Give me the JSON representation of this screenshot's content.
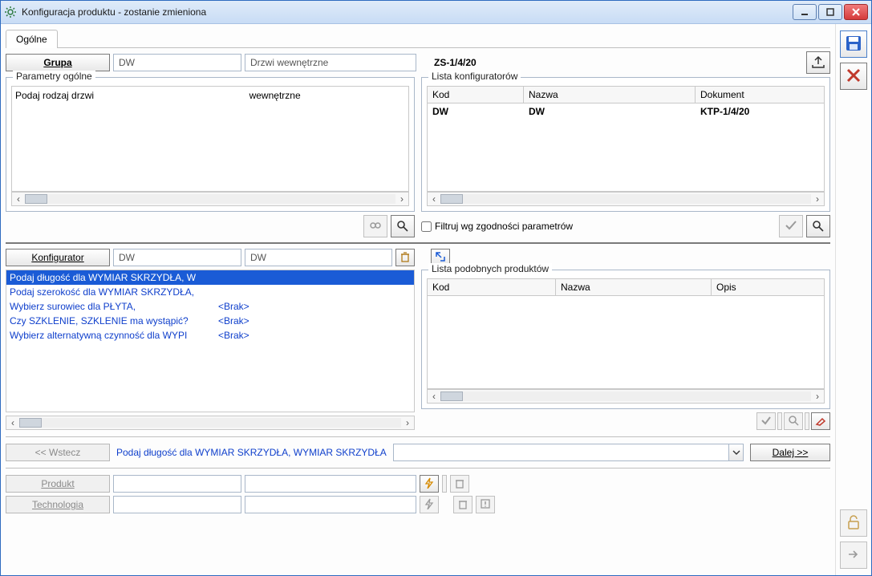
{
  "window": {
    "title": "Konfiguracja produktu - zostanie zmieniona"
  },
  "tabs": {
    "general": "Ogólne"
  },
  "grupa": {
    "btn": "Grupa",
    "code": "DW",
    "name": "Drzwi wewnętrzne"
  },
  "document_code": "ZS-1/4/20",
  "parametry_ogolne": {
    "legend": "Parametry ogólne",
    "col_label": "Podaj rodzaj drzwi",
    "col_value": "wewnętrzne"
  },
  "lista_konfiguratorow": {
    "legend": "Lista konfiguratorów",
    "hdr": {
      "kod": "Kod",
      "nazwa": "Nazwa",
      "dokument": "Dokument"
    },
    "rows": [
      {
        "kod": "DW",
        "nazwa": "DW",
        "dokument": "KTP-1/4/20"
      }
    ],
    "filter_label": "Filtruj wg zgodności parametrów"
  },
  "konfigurator": {
    "btn": "Konfigurator",
    "code": "DW",
    "name": "DW"
  },
  "steps": [
    {
      "label": "Podaj długość dla WYMIAR SKRZYDŁA, W",
      "value": "",
      "selected": true
    },
    {
      "label": "Podaj szerokość dla WYMIAR SKRZYDŁA,",
      "value": "",
      "selected": false
    },
    {
      "label": "Wybierz surowiec dla PŁYTA,",
      "value": "<Brak>",
      "selected": false
    },
    {
      "label": "Czy SZKLENIE, SZKLENIE ma wystąpić?",
      "value": "<Brak>",
      "selected": false
    },
    {
      "label": "Wybierz alternatywną czynność dla WYPI",
      "value": "<Brak>",
      "selected": false
    }
  ],
  "lista_podobnych": {
    "legend": "Lista podobnych produktów",
    "hdr": {
      "kod": "Kod",
      "nazwa": "Nazwa",
      "opis": "Opis"
    }
  },
  "wizard": {
    "back": "<< Wstecz",
    "prompt": "Podaj długość dla WYMIAR SKRZYDŁA, WYMIAR SKRZYDŁA",
    "next": "Dalej >>"
  },
  "produkt_label": "Produkt",
  "technologia_label": "Technologia"
}
